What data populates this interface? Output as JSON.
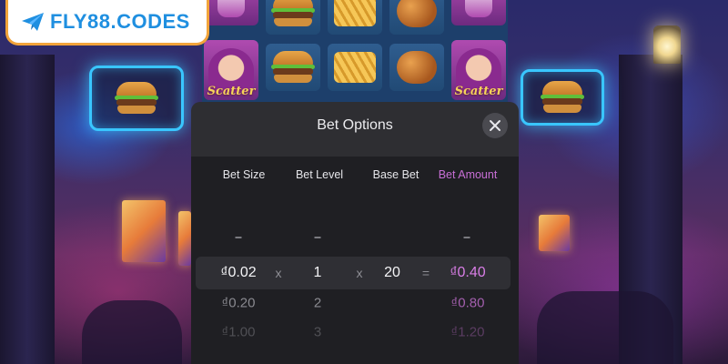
{
  "logo": {
    "text": "FLY88.CODES",
    "icon": "paper-plane-icon",
    "brand_color": "#1f8fe0",
    "border_color": "#f2a43a"
  },
  "reels": {
    "symbols_top": [
      "drink",
      "burger",
      "fries",
      "chicken",
      "drink"
    ],
    "symbols_mid": [
      "scatter-girl",
      "burger",
      "fries",
      "chicken",
      "scatter-girl"
    ],
    "scatter_label": "Scatter"
  },
  "modal": {
    "title": "Bet Options",
    "close_icon": "close-icon",
    "columns": [
      "Bet Size",
      "Bet Level",
      "Base Bet",
      "Bet Amount"
    ],
    "placeholder": "-",
    "operators": {
      "times": "x",
      "equals": "="
    },
    "selected_row": {
      "bet_size": "₫0.02",
      "bet_level": "1",
      "base_bet": "20",
      "bet_amount": "₫0.40"
    },
    "rows": [
      {
        "bet_size": "₫0.20",
        "bet_level": "2",
        "bet_amount": "₫0.80"
      },
      {
        "bet_size": "₫1.00",
        "bet_level": "3",
        "bet_amount": "₫1.20"
      }
    ],
    "accent_color": "#c86fd6"
  }
}
